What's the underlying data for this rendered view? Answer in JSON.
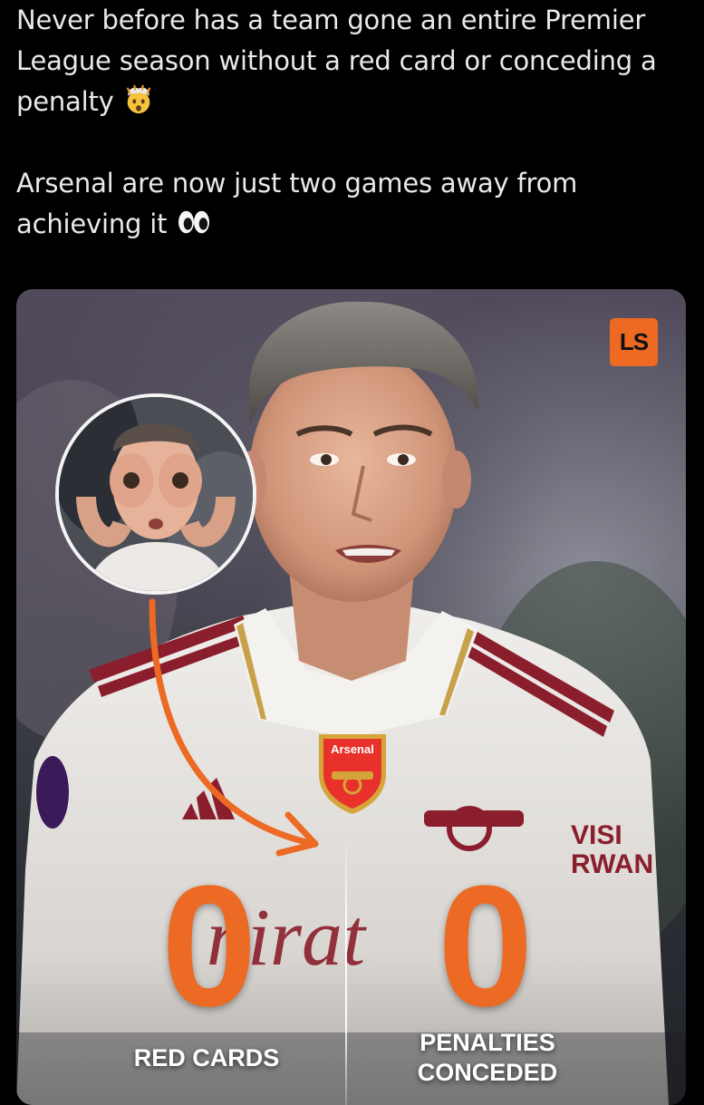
{
  "tweet": {
    "line1": "Never before has a team gone an entire Premier League season without a red card or conceding a penalty",
    "line1_emoji": "exploding-head-emoji",
    "line2": "Arsenal are now just two games away from achieving it",
    "line2_emoji": "eyes-emoji"
  },
  "card": {
    "brand_logo": "LS",
    "badge_text": "Arsenal",
    "stats": [
      {
        "value": "0",
        "label": "RED CARDS"
      },
      {
        "value": "0",
        "label": "PENALTIES CONCEDED"
      }
    ],
    "colors": {
      "accent": "#ec6a23",
      "logo_bg": "#ee6a22",
      "shirt": "#ece9e6",
      "shirt_trim": "#8b1e2c"
    }
  }
}
